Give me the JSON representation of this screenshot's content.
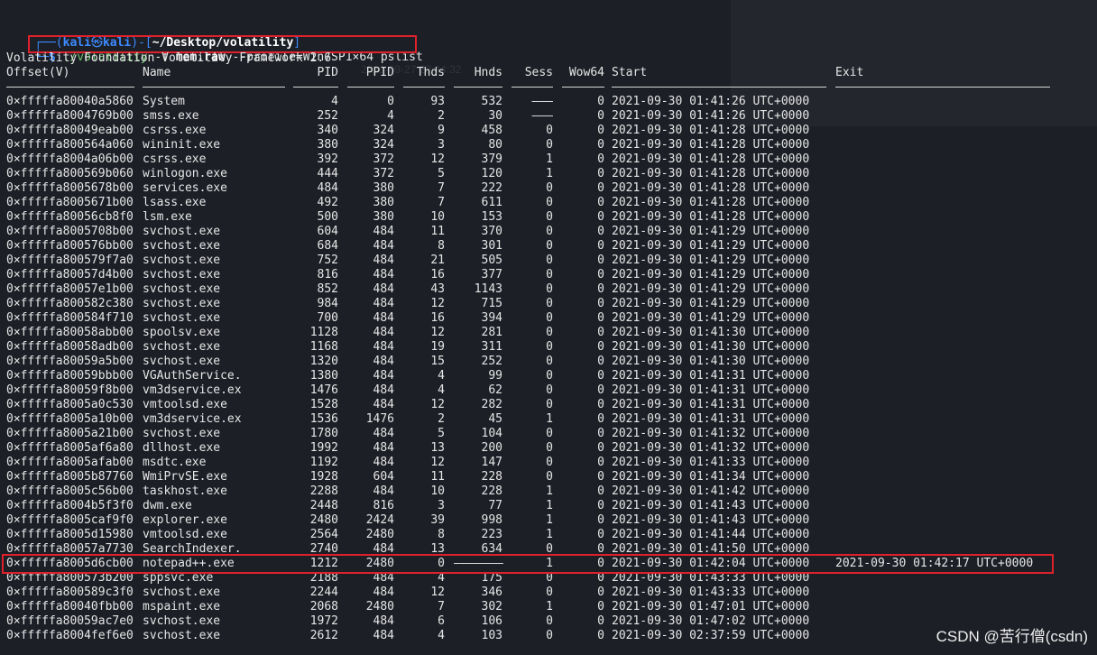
{
  "prompt": {
    "user": "kali",
    "at": "㉿",
    "host": "kali",
    "path": "~/Desktop/volatility",
    "dollar": "$",
    "command_tool": "./volatility",
    "command_flag_f": "-f",
    "command_file": "mem.raw",
    "command_profile": "--profile=Win7SP1×64",
    "command_plugin": "pslist"
  },
  "banner": "Volatility Foundation Volatility Framework 2.6",
  "columns": {
    "offset": "Offset(V)",
    "name": "Name",
    "pid": "PID",
    "ppid": "PPID",
    "thds": "Thds",
    "hnds": "Hnds",
    "sess": "Sess",
    "wow64": "Wow64",
    "start": "Start",
    "exit": "Exit"
  },
  "rows": [
    {
      "offset": "0×fffffa80040a5860",
      "name": "System",
      "pid": "4",
      "ppid": "0",
      "thds": "93",
      "hnds": "532",
      "sess": "———",
      "wow64": "0",
      "start": "2021-09-30 01:41:26 UTC+0000",
      "exit": ""
    },
    {
      "offset": "0×fffffa8004769b00",
      "name": "smss.exe",
      "pid": "252",
      "ppid": "4",
      "thds": "2",
      "hnds": "30",
      "sess": "———",
      "wow64": "0",
      "start": "2021-09-30 01:41:26 UTC+0000",
      "exit": ""
    },
    {
      "offset": "0×fffffa80049eab00",
      "name": "csrss.exe",
      "pid": "340",
      "ppid": "324",
      "thds": "9",
      "hnds": "458",
      "sess": "0",
      "wow64": "0",
      "start": "2021-09-30 01:41:28 UTC+0000",
      "exit": ""
    },
    {
      "offset": "0×fffffa800564a060",
      "name": "wininit.exe",
      "pid": "380",
      "ppid": "324",
      "thds": "3",
      "hnds": "80",
      "sess": "0",
      "wow64": "0",
      "start": "2021-09-30 01:41:28 UTC+0000",
      "exit": ""
    },
    {
      "offset": "0×fffffa8004a06b00",
      "name": "csrss.exe",
      "pid": "392",
      "ppid": "372",
      "thds": "12",
      "hnds": "379",
      "sess": "1",
      "wow64": "0",
      "start": "2021-09-30 01:41:28 UTC+0000",
      "exit": ""
    },
    {
      "offset": "0×fffffa800569b060",
      "name": "winlogon.exe",
      "pid": "444",
      "ppid": "372",
      "thds": "5",
      "hnds": "120",
      "sess": "1",
      "wow64": "0",
      "start": "2021-09-30 01:41:28 UTC+0000",
      "exit": ""
    },
    {
      "offset": "0×fffffa8005678b00",
      "name": "services.exe",
      "pid": "484",
      "ppid": "380",
      "thds": "7",
      "hnds": "222",
      "sess": "0",
      "wow64": "0",
      "start": "2021-09-30 01:41:28 UTC+0000",
      "exit": ""
    },
    {
      "offset": "0×fffffa8005671b00",
      "name": "lsass.exe",
      "pid": "492",
      "ppid": "380",
      "thds": "7",
      "hnds": "611",
      "sess": "0",
      "wow64": "0",
      "start": "2021-09-30 01:41:28 UTC+0000",
      "exit": ""
    },
    {
      "offset": "0×fffffa80056cb8f0",
      "name": "lsm.exe",
      "pid": "500",
      "ppid": "380",
      "thds": "10",
      "hnds": "153",
      "sess": "0",
      "wow64": "0",
      "start": "2021-09-30 01:41:28 UTC+0000",
      "exit": ""
    },
    {
      "offset": "0×fffffa8005708b00",
      "name": "svchost.exe",
      "pid": "604",
      "ppid": "484",
      "thds": "11",
      "hnds": "370",
      "sess": "0",
      "wow64": "0",
      "start": "2021-09-30 01:41:29 UTC+0000",
      "exit": ""
    },
    {
      "offset": "0×fffffa800576bb00",
      "name": "svchost.exe",
      "pid": "684",
      "ppid": "484",
      "thds": "8",
      "hnds": "301",
      "sess": "0",
      "wow64": "0",
      "start": "2021-09-30 01:41:29 UTC+0000",
      "exit": ""
    },
    {
      "offset": "0×fffffa800579f7a0",
      "name": "svchost.exe",
      "pid": "752",
      "ppid": "484",
      "thds": "21",
      "hnds": "505",
      "sess": "0",
      "wow64": "0",
      "start": "2021-09-30 01:41:29 UTC+0000",
      "exit": ""
    },
    {
      "offset": "0×fffffa80057d4b00",
      "name": "svchost.exe",
      "pid": "816",
      "ppid": "484",
      "thds": "16",
      "hnds": "377",
      "sess": "0",
      "wow64": "0",
      "start": "2021-09-30 01:41:29 UTC+0000",
      "exit": ""
    },
    {
      "offset": "0×fffffa80057e1b00",
      "name": "svchost.exe",
      "pid": "852",
      "ppid": "484",
      "thds": "43",
      "hnds": "1143",
      "sess": "0",
      "wow64": "0",
      "start": "2021-09-30 01:41:29 UTC+0000",
      "exit": ""
    },
    {
      "offset": "0×fffffa800582c380",
      "name": "svchost.exe",
      "pid": "984",
      "ppid": "484",
      "thds": "12",
      "hnds": "715",
      "sess": "0",
      "wow64": "0",
      "start": "2021-09-30 01:41:29 UTC+0000",
      "exit": ""
    },
    {
      "offset": "0×fffffa800584f710",
      "name": "svchost.exe",
      "pid": "700",
      "ppid": "484",
      "thds": "16",
      "hnds": "394",
      "sess": "0",
      "wow64": "0",
      "start": "2021-09-30 01:41:29 UTC+0000",
      "exit": ""
    },
    {
      "offset": "0×fffffa80058abb00",
      "name": "spoolsv.exe",
      "pid": "1128",
      "ppid": "484",
      "thds": "12",
      "hnds": "281",
      "sess": "0",
      "wow64": "0",
      "start": "2021-09-30 01:41:30 UTC+0000",
      "exit": ""
    },
    {
      "offset": "0×fffffa80058adb00",
      "name": "svchost.exe",
      "pid": "1168",
      "ppid": "484",
      "thds": "19",
      "hnds": "311",
      "sess": "0",
      "wow64": "0",
      "start": "2021-09-30 01:41:30 UTC+0000",
      "exit": ""
    },
    {
      "offset": "0×fffffa80059a5b00",
      "name": "svchost.exe",
      "pid": "1320",
      "ppid": "484",
      "thds": "15",
      "hnds": "252",
      "sess": "0",
      "wow64": "0",
      "start": "2021-09-30 01:41:30 UTC+0000",
      "exit": ""
    },
    {
      "offset": "0×fffffa80059bbb00",
      "name": "VGAuthService.",
      "pid": "1380",
      "ppid": "484",
      "thds": "4",
      "hnds": "99",
      "sess": "0",
      "wow64": "0",
      "start": "2021-09-30 01:41:31 UTC+0000",
      "exit": ""
    },
    {
      "offset": "0×fffffa80059f8b00",
      "name": "vm3dservice.ex",
      "pid": "1476",
      "ppid": "484",
      "thds": "4",
      "hnds": "62",
      "sess": "0",
      "wow64": "0",
      "start": "2021-09-30 01:41:31 UTC+0000",
      "exit": ""
    },
    {
      "offset": "0×fffffa8005a0c530",
      "name": "vmtoolsd.exe",
      "pid": "1528",
      "ppid": "484",
      "thds": "12",
      "hnds": "282",
      "sess": "0",
      "wow64": "0",
      "start": "2021-09-30 01:41:31 UTC+0000",
      "exit": ""
    },
    {
      "offset": "0×fffffa8005a10b00",
      "name": "vm3dservice.ex",
      "pid": "1536",
      "ppid": "1476",
      "thds": "2",
      "hnds": "45",
      "sess": "1",
      "wow64": "0",
      "start": "2021-09-30 01:41:31 UTC+0000",
      "exit": ""
    },
    {
      "offset": "0×fffffa8005a21b00",
      "name": "svchost.exe",
      "pid": "1780",
      "ppid": "484",
      "thds": "5",
      "hnds": "104",
      "sess": "0",
      "wow64": "0",
      "start": "2021-09-30 01:41:32 UTC+0000",
      "exit": ""
    },
    {
      "offset": "0×fffffa8005af6a80",
      "name": "dllhost.exe",
      "pid": "1992",
      "ppid": "484",
      "thds": "13",
      "hnds": "200",
      "sess": "0",
      "wow64": "0",
      "start": "2021-09-30 01:41:32 UTC+0000",
      "exit": ""
    },
    {
      "offset": "0×fffffa8005afab00",
      "name": "msdtc.exe",
      "pid": "1192",
      "ppid": "484",
      "thds": "12",
      "hnds": "147",
      "sess": "0",
      "wow64": "0",
      "start": "2021-09-30 01:41:33 UTC+0000",
      "exit": ""
    },
    {
      "offset": "0×fffffa8005b87760",
      "name": "WmiPrvSE.exe",
      "pid": "1928",
      "ppid": "604",
      "thds": "11",
      "hnds": "228",
      "sess": "0",
      "wow64": "0",
      "start": "2021-09-30 01:41:34 UTC+0000",
      "exit": ""
    },
    {
      "offset": "0×fffffa8005c56b00",
      "name": "taskhost.exe",
      "pid": "2288",
      "ppid": "484",
      "thds": "10",
      "hnds": "228",
      "sess": "1",
      "wow64": "0",
      "start": "2021-09-30 01:41:42 UTC+0000",
      "exit": ""
    },
    {
      "offset": "0×fffffa8004b5f3f0",
      "name": "dwm.exe",
      "pid": "2448",
      "ppid": "816",
      "thds": "3",
      "hnds": "77",
      "sess": "1",
      "wow64": "0",
      "start": "2021-09-30 01:41:43 UTC+0000",
      "exit": ""
    },
    {
      "offset": "0×fffffa8005caf9f0",
      "name": "explorer.exe",
      "pid": "2480",
      "ppid": "2424",
      "thds": "39",
      "hnds": "998",
      "sess": "1",
      "wow64": "0",
      "start": "2021-09-30 01:41:43 UTC+0000",
      "exit": ""
    },
    {
      "offset": "0×fffffa8005d15980",
      "name": "vmtoolsd.exe",
      "pid": "2564",
      "ppid": "2480",
      "thds": "8",
      "hnds": "223",
      "sess": "1",
      "wow64": "0",
      "start": "2021-09-30 01:41:44 UTC+0000",
      "exit": ""
    },
    {
      "offset": "0×fffffa80057a7730",
      "name": "SearchIndexer.",
      "pid": "2740",
      "ppid": "484",
      "thds": "13",
      "hnds": "634",
      "sess": "0",
      "wow64": "0",
      "start": "2021-09-30 01:41:50 UTC+0000",
      "exit": ""
    },
    {
      "offset": "0×fffffa8005d6cb00",
      "name": "notepad++.exe",
      "pid": "1212",
      "ppid": "2480",
      "thds": "0",
      "hnds": "———————",
      "sess": "1",
      "wow64": "0",
      "start": "2021-09-30 01:42:04 UTC+0000",
      "exit": "2021-09-30 01:42:17 UTC+0000"
    },
    {
      "offset": "0×fffffa800573b200",
      "name": "sppsvc.exe",
      "pid": "2188",
      "ppid": "484",
      "thds": "4",
      "hnds": "175",
      "sess": "0",
      "wow64": "0",
      "start": "2021-09-30 01:43:33 UTC+0000",
      "exit": ""
    },
    {
      "offset": "0×fffffa800589c3f0",
      "name": "svchost.exe",
      "pid": "2244",
      "ppid": "484",
      "thds": "12",
      "hnds": "346",
      "sess": "0",
      "wow64": "0",
      "start": "2021-09-30 01:43:33 UTC+0000",
      "exit": ""
    },
    {
      "offset": "0×fffffa80040fbb00",
      "name": "mspaint.exe",
      "pid": "2068",
      "ppid": "2480",
      "thds": "7",
      "hnds": "302",
      "sess": "1",
      "wow64": "0",
      "start": "2021-09-30 01:47:01 UTC+0000",
      "exit": ""
    },
    {
      "offset": "0×fffffa80059ac7e0",
      "name": "svchost.exe",
      "pid": "1972",
      "ppid": "484",
      "thds": "6",
      "hnds": "106",
      "sess": "0",
      "wow64": "0",
      "start": "2021-09-30 01:47:02 UTC+0000",
      "exit": ""
    },
    {
      "offset": "0×fffffa8004fef6e0",
      "name": "svchost.exe",
      "pid": "2612",
      "ppid": "484",
      "thds": "4",
      "hnds": "103",
      "sess": "0",
      "wow64": "0",
      "start": "2021-09-30 02:37:59 UTC+0000",
      "exit": ""
    }
  ],
  "watermark": "CSDN @苦行僧(csdn)",
  "colors": {
    "background": "#1c1f26",
    "prompt_blue": "#3d8bff",
    "highlight_red": "#e0212b",
    "command_green": "#6ec06e"
  }
}
